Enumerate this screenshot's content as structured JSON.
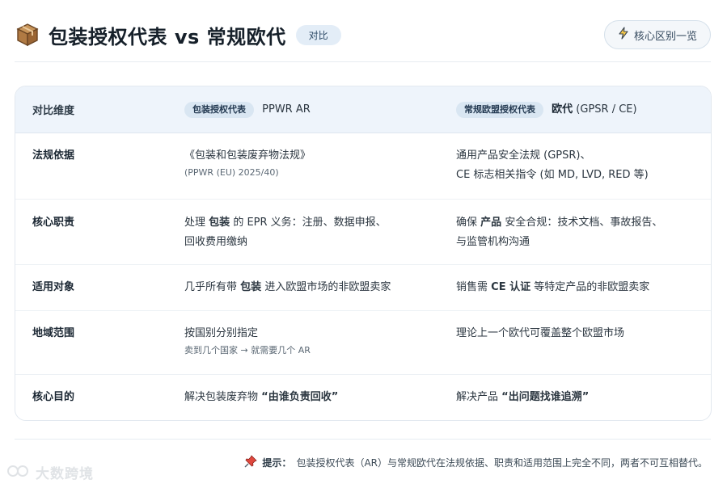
{
  "header": {
    "title": "包装授权代表 vs 常规欧代",
    "badge": "对比",
    "button_label": "核心区别一览",
    "title_icon": "package-icon",
    "button_icon": "lightning-icon"
  },
  "table": {
    "headers": {
      "dimension": "对比维度",
      "col1_pill": "包装授权代表",
      "col1_text": "PPWR AR",
      "col2_pill": "常规欧盟授权代表",
      "col2_text_bold": "欧代",
      "col2_text": "(GPSR / CE)"
    },
    "rows": [
      {
        "label": "法规依据",
        "col1_main": "《包装和包装废弃物法规》",
        "col1_sub": "(PPWR (EU) 2025/40)",
        "col2_line1": "通用产品安全法规 (GPSR)、",
        "col2_line2": "CE 标志相关指令 (如 MD, LVD, RED 等)"
      },
      {
        "label": "核心职责",
        "col1_pre": "处理",
        "col1_bold": "包装",
        "col1_post": "的 EPR 义务：注册、数据申报、",
        "col1_line2": "回收费用缴纳",
        "col2_pre": "确保",
        "col2_bold": "产品",
        "col2_post": "安全合规：技术文档、事故报告、",
        "col2_line2": "与监管机构沟通"
      },
      {
        "label": "适用对象",
        "col1_pre": "几乎所有带",
        "col1_bold": "包装",
        "col1_post": "进入欧盟市场的非欧盟卖家",
        "col2_pre": "销售需",
        "col2_bold": "CE 认证",
        "col2_post": "等特定产品的非欧盟卖家"
      },
      {
        "label": "地域范围",
        "col1_main": "按国别分别指定",
        "col1_sub": "卖到几个国家 → 就需要几个 AR",
        "col2_main": "理论上一个欧代可覆盖整个欧盟市场"
      },
      {
        "label": "核心目的",
        "col1_pre": "解决包装废弃物",
        "col1_bold": "“由谁负责回收”",
        "col2_pre": "解决产品",
        "col2_bold": "“出问题找谁追溯”"
      }
    ]
  },
  "footer": {
    "tip_label": "提示：",
    "tip_text": "包装授权代表（AR）与常规欧代在法规依据、职责和适用范围上完全不同，两者不可互相替代。",
    "tip_icon": "pushpin-icon"
  },
  "watermark": {
    "text": "大数跨境"
  },
  "colors": {
    "header_band": "#eef4fb",
    "pill_bg": "#d9e6f2",
    "badge_bg": "#e3edf7"
  }
}
